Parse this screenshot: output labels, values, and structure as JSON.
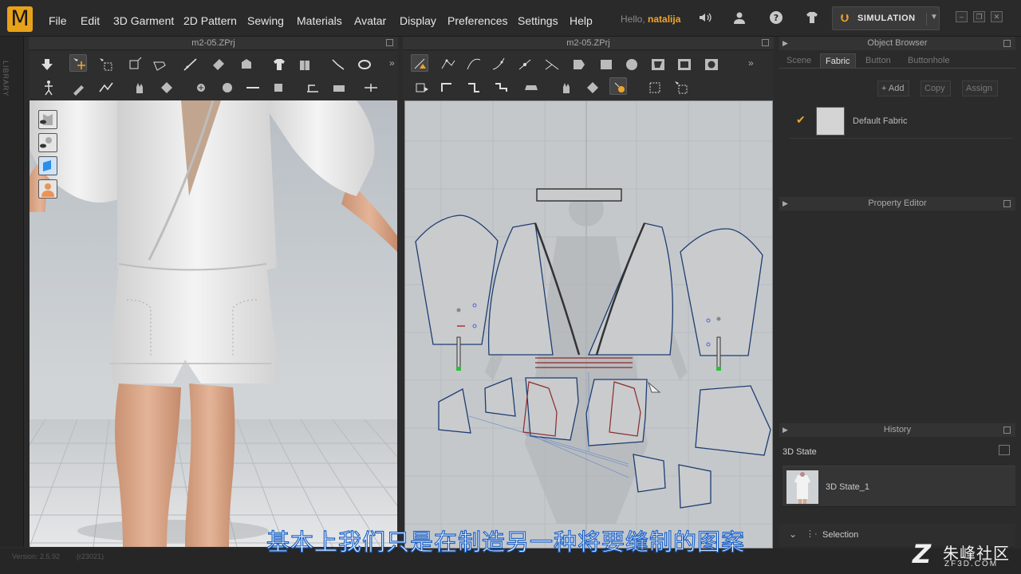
{
  "app": {
    "logo_letter": "M",
    "menu": [
      "File",
      "Edit",
      "3D Garment",
      "2D Pattern",
      "Sewing",
      "Materials",
      "Avatar",
      "Display",
      "Preferences",
      "Settings",
      "Help"
    ],
    "hello_prefix": "Hello,",
    "user": "natalija",
    "simulation_label": "SIMULATION",
    "accent": "#f0a52a"
  },
  "library_label": "LIBRARY",
  "view3d": {
    "title": "m2-05.ZPrj"
  },
  "view2d": {
    "title": "m2-05.ZPrj"
  },
  "object_browser": {
    "title": "Object Browser",
    "tabs": [
      "Scene",
      "Fabric",
      "Button",
      "Buttonhole"
    ],
    "active_tab": "Fabric",
    "actions": [
      "+ Add",
      "Copy",
      "Assign"
    ],
    "fabric_item": "Default Fabric"
  },
  "property_editor": {
    "title": "Property Editor"
  },
  "history": {
    "title": "History",
    "state_header": "3D State",
    "state_item": "3D State_1"
  },
  "selection_label": "Selection",
  "status": {
    "version": "Version: 2.5.92",
    "build": "(r23021)"
  },
  "subtitle": "基本上我们只是在制造另一种将要缝制的图案",
  "watermark": {
    "logo": "Z",
    "name": "朱峰社区",
    "site": "ZF3D.COM"
  }
}
